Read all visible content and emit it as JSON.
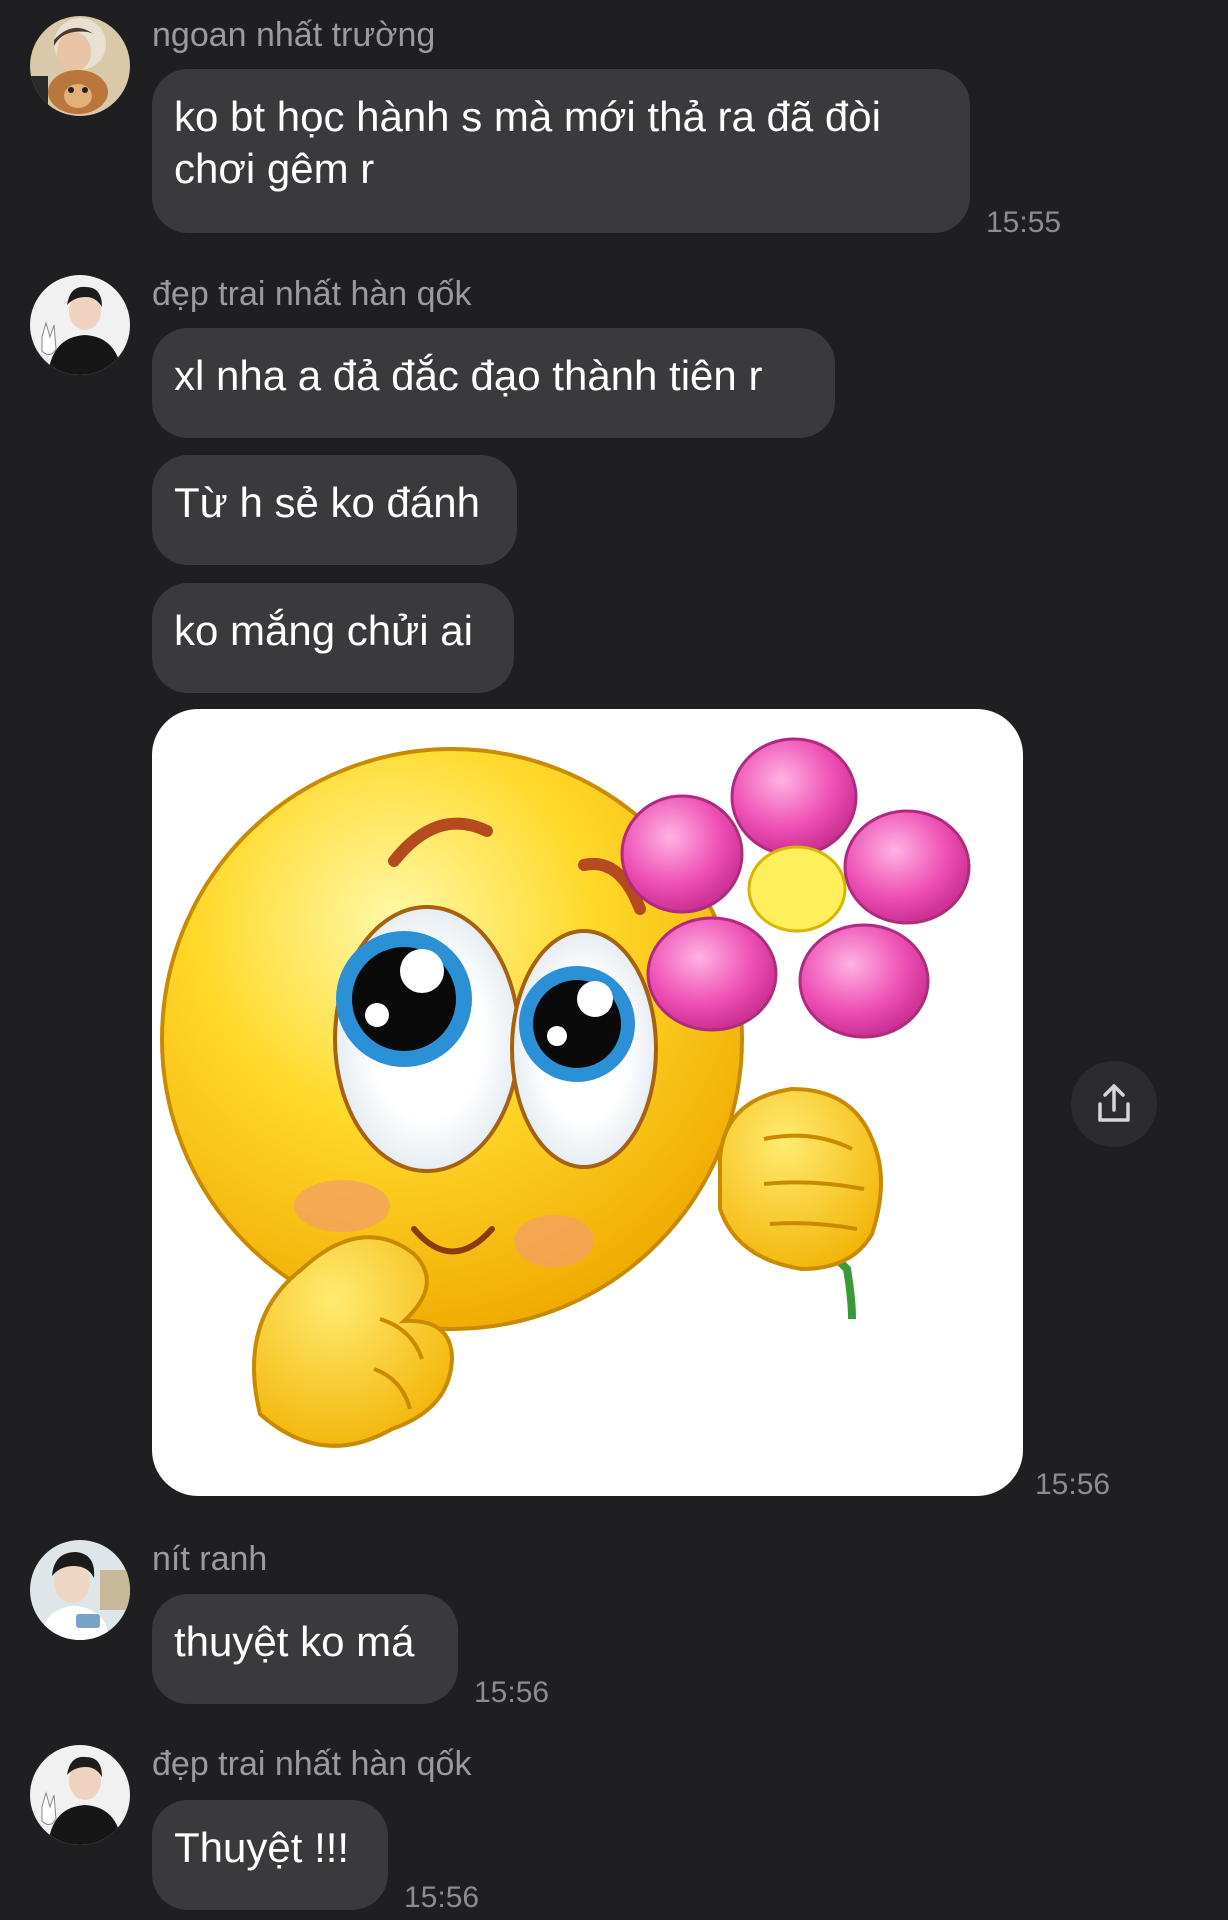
{
  "messages": [
    {
      "sender": "ngoan nhất trường",
      "avatar_icon": "user-avatar-with-dog",
      "bubbles": [
        "ko bt học hành s mà mới thả ra đã đòi chơi gêm r"
      ],
      "time": "15:55"
    },
    {
      "sender": "đẹp trai nhất hàn qốk",
      "avatar_icon": "user-avatar-dark-shirt",
      "bubbles": [
        "xl nha a đả đắc đạo thành tiên r",
        "Từ h sẻ ko đánh",
        "ko mắng chửi ai"
      ],
      "sticker": "smiley-holding-flower-sticker",
      "time": "15:56"
    },
    {
      "sender": "nít ranh",
      "avatar_icon": "user-avatar-light",
      "bubbles": [
        "thuyệt ko má"
      ],
      "time": "15:56"
    },
    {
      "sender": "đẹp trai nhất hàn qốk",
      "avatar_icon": "user-avatar-dark-shirt",
      "bubbles": [
        "Thuyệt !!!"
      ],
      "time": "15:56"
    }
  ],
  "share_icon": "share-icon",
  "colors": {
    "background": "#1f1f21",
    "bubble": "#3a3a3d",
    "sender_text": "#9a9a9f",
    "time_text": "#8c8c91"
  }
}
